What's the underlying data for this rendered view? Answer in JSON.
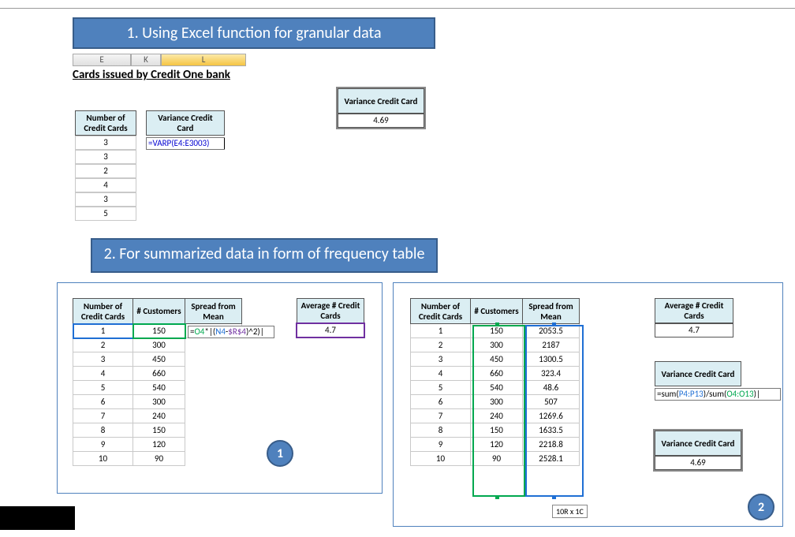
{
  "banners": {
    "b1": "1. Using Excel function for granular data",
    "b2": "2. For summarized data in form of frequency table"
  },
  "columns": {
    "e": "E",
    "k": "K",
    "l": "L"
  },
  "subtitle": "Cards issued by Credit One bank",
  "section1": {
    "hdr_numcc": "Number of Credit Cards",
    "hdr_var": "Variance Credit Card",
    "formula": "=VARP(E4:E3003)",
    "data": [
      "3",
      "3",
      "2",
      "4",
      "3",
      "5"
    ],
    "var_value": "4.69"
  },
  "leftpanel": {
    "headers": {
      "ncc": "Number of Credit Cards",
      "cust": "# Customers",
      "spread": "Spread from Mean",
      "avg": "Average # Credit Cards"
    },
    "avg_value": "4.7",
    "formula_parts": {
      "pre": "=",
      "o4": "O4",
      "mid": "*|(",
      "n4": "N4",
      "mid2": "-",
      "r4": "$R$4",
      "post": ")^2)|"
    },
    "rows": [
      {
        "n": "1",
        "c": "150"
      },
      {
        "n": "2",
        "c": "300"
      },
      {
        "n": "3",
        "c": "450"
      },
      {
        "n": "4",
        "c": "660"
      },
      {
        "n": "5",
        "c": "540"
      },
      {
        "n": "6",
        "c": "300"
      },
      {
        "n": "7",
        "c": "240"
      },
      {
        "n": "8",
        "c": "150"
      },
      {
        "n": "9",
        "c": "120"
      },
      {
        "n": "10",
        "c": "90"
      }
    ]
  },
  "rightpanel": {
    "headers": {
      "ncc": "Number of Credit Cards",
      "cust": "# Customers",
      "spread": "Spread from Mean",
      "avg": "Average # Credit Cards",
      "var": "Variance Credit Card"
    },
    "avg_value": "4.7",
    "formula_parts": {
      "pre": "=sum(",
      "p": "P4:P13",
      "mid": ")/sum(",
      "o": "O4:O13",
      "post": ")|"
    },
    "var_value": "4.69",
    "rc_indicator": "10R x 1C",
    "rows": [
      {
        "n": "1",
        "c": "150",
        "s": "2053.5"
      },
      {
        "n": "2",
        "c": "300",
        "s": "2187"
      },
      {
        "n": "3",
        "c": "450",
        "s": "1300.5"
      },
      {
        "n": "4",
        "c": "660",
        "s": "323.4"
      },
      {
        "n": "5",
        "c": "540",
        "s": "48.6"
      },
      {
        "n": "6",
        "c": "300",
        "s": "507"
      },
      {
        "n": "7",
        "c": "240",
        "s": "1269.6"
      },
      {
        "n": "8",
        "c": "150",
        "s": "1633.5"
      },
      {
        "n": "9",
        "c": "120",
        "s": "2218.8"
      },
      {
        "n": "10",
        "c": "90",
        "s": "2528.1"
      }
    ]
  },
  "badges": {
    "b1": "1",
    "b2": "2"
  }
}
